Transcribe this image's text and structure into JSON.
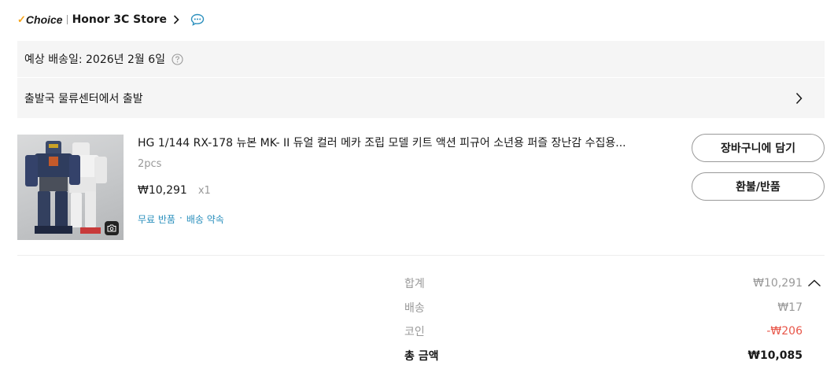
{
  "store": {
    "choice_label": "Choice",
    "name": "Honor 3C Store"
  },
  "delivery": {
    "estimated_date": "예상 배송일: 2026년 2월 6일",
    "departure": "출발국 물류센터에서 출발"
  },
  "product": {
    "title": "HG 1/144 RX-178 뉴본 MK- II  듀얼 컬러 메카 조립 모델 키트 액션 피규어 소년용 퍼즐 장난감 수집용...",
    "variant": "2pcs",
    "price": "₩10,291",
    "quantity": "x1",
    "services": [
      "무료 반품",
      "배송 약속"
    ],
    "service_separator": "·",
    "buttons": {
      "add_to_cart": "장바구니에 담기",
      "refund": "환불/반품"
    }
  },
  "summary": {
    "subtotal_label": "합계",
    "subtotal_value": "₩10,291",
    "shipping_label": "배송",
    "shipping_value": "₩17",
    "coin_label": "코인",
    "coin_value": "-₩206",
    "total_label": "총 금액",
    "total_value": "₩10,085"
  },
  "colors": {
    "choice_check": "#f7a51c",
    "link_blue": "#2a8fbd",
    "discount_red": "#e8574a",
    "panel_bg": "#f5f5f5"
  },
  "icons": [
    "chevron-right-icon",
    "chat-icon",
    "help-icon",
    "camera-icon",
    "chevron-up-icon"
  ]
}
